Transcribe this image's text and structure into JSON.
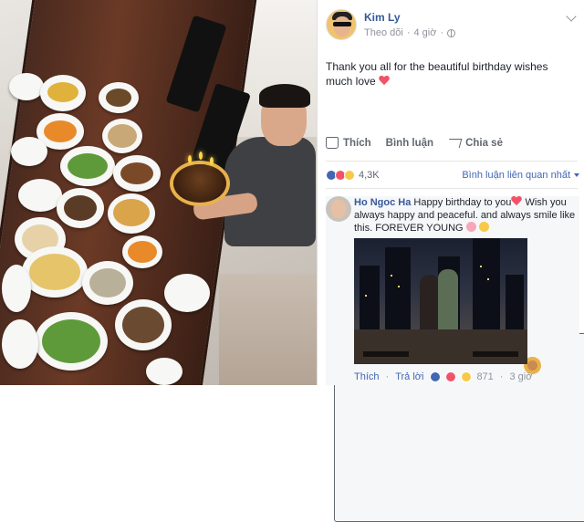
{
  "post": {
    "author": "Kim Ly",
    "follow_label": "Theo dõi",
    "time": "4 giờ",
    "message": "Thank you all for the beautiful birthday wishes much love"
  },
  "actions": {
    "like": "Thích",
    "comment": "Bình luận",
    "share": "Chia sẻ"
  },
  "reactions": {
    "count": "4,3K",
    "sort_label": "Bình luận liên quan nhất",
    "icons": [
      "like-icon",
      "love-icon",
      "wow-icon"
    ]
  },
  "comment": {
    "author": "Ho Ngoc Ha",
    "text_part1": "Happy birthday to you",
    "text_part2": "Wish you always happy and peaceful. and always smile like this. FOREVER YOUNG",
    "like_label": "Thích",
    "reply_label": "Trả lời",
    "reaction_count": "871",
    "time": "3 giờ"
  },
  "colors": {
    "link_blue": "#365899",
    "accent_blue": "#4267b2",
    "muted": "#90949c",
    "heart": "#f25268"
  }
}
